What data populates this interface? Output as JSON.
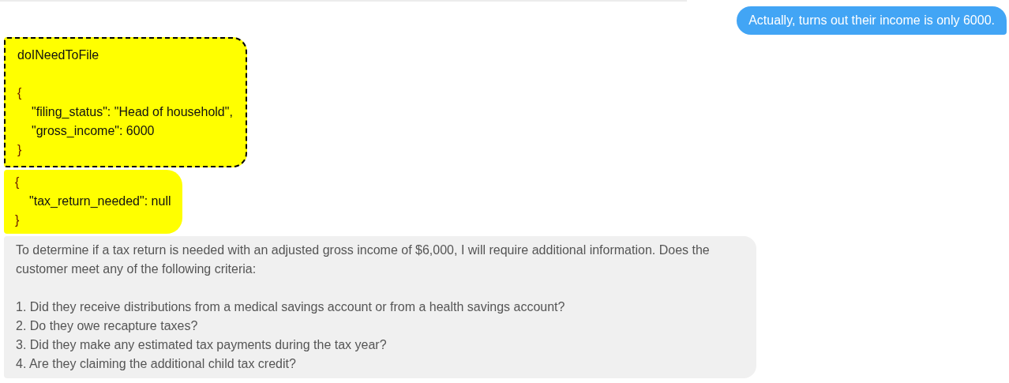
{
  "messages": [
    {
      "kind": "user",
      "text": "Actually, turns out their income is only 6000."
    },
    {
      "kind": "function_call",
      "name": "doINeedToFile",
      "lines": [
        {
          "kind": "brace",
          "text": "{"
        },
        {
          "kind": "field",
          "text": "\"filing_status\": \"Head of household\","
        },
        {
          "kind": "field",
          "text": "\"gross_income\": 6000"
        },
        {
          "kind": "brace",
          "text": "}"
        }
      ]
    },
    {
      "kind": "function_result",
      "lines": [
        {
          "kind": "brace",
          "text": "{"
        },
        {
          "kind": "field",
          "text": "\"tax_return_needed\": null"
        },
        {
          "kind": "brace",
          "text": "}"
        }
      ]
    },
    {
      "kind": "assistant",
      "intro": "To determine if a tax return is needed with an adjusted gross income of $6,000, I will require additional information. Does the customer meet any of the following criteria:",
      "items": [
        "1. Did they receive distributions from a medical savings account or from a health savings account?",
        "2. Do they owe recapture taxes?",
        "3. Did they make any estimated tax payments during the tax year?",
        "4. Are they claiming the additional child tax credit?"
      ]
    }
  ]
}
